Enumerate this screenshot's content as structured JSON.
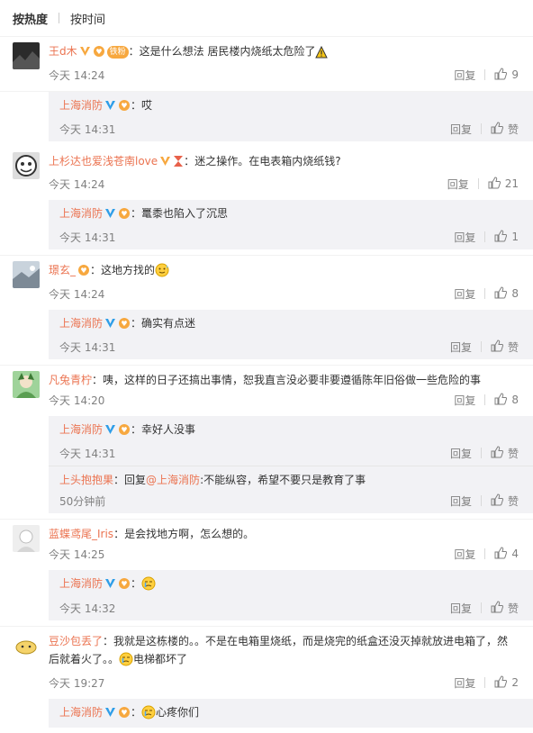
{
  "tabs": {
    "hot": "按热度",
    "time": "按时间"
  },
  "labels": {
    "reply": "回复",
    "like": "赞"
  },
  "comments": [
    {
      "user": "王d木",
      "sep": "：",
      "fan_badge": "铁粉",
      "text": "这是什么想法 居民楼内烧纸太危险了",
      "time": "今天 14:24",
      "likes": "9",
      "replies": [
        {
          "user": "上海消防",
          "sep": "：",
          "text": "哎",
          "time": "今天 14:31",
          "likes": "赞"
        }
      ]
    },
    {
      "user": "上杉达也爱浅苍南love",
      "sep": "：",
      "text": "迷之操作。在电表箱内烧纸钱?",
      "time": "今天 14:24",
      "likes": "21",
      "replies": [
        {
          "user": "上海消防",
          "sep": "：",
          "text": "鼍黍也陷入了沉思",
          "time": "今天 14:31",
          "likes": "1"
        }
      ]
    },
    {
      "user": "璟玄_",
      "sep": "：",
      "text": "这地方找的",
      "time": "今天 14:24",
      "likes": "8",
      "replies": [
        {
          "user": "上海消防",
          "sep": "：",
          "text": "确实有点迷",
          "time": "今天 14:31",
          "likes": "赞"
        }
      ]
    },
    {
      "user": "凡兔青柠",
      "sep": "：",
      "text": "咦，这样的日子还搞出事情，恕我直言没必要非要遵循陈年旧俗做一些危险的事",
      "time": "今天 14:20",
      "likes": "8",
      "replies": [
        {
          "user": "上海消防",
          "sep": "：",
          "text": "幸好人没事",
          "time": "今天 14:31",
          "likes": "赞"
        },
        {
          "user": "上头抱抱果",
          "sep": "：",
          "pre": "回复",
          "mention": "@上海消防",
          "text": ":不能纵容，希望不要只是教育了事",
          "time": "50分钟前",
          "likes": "赞"
        }
      ]
    },
    {
      "user": "蓝蝶鸢尾_Iris",
      "sep": "：",
      "text": "是会找地方啊，怎么想的。",
      "time": "今天 14:25",
      "likes": "4",
      "replies": [
        {
          "user": "上海消防",
          "sep": "：",
          "text": "",
          "time": "今天 14:32",
          "likes": "赞"
        }
      ]
    },
    {
      "user": "豆沙包丢了",
      "sep": "：",
      "text": "我就是这栋楼的。。不是在电箱里烧纸，而是烧完的纸盒还没灭掉就放进电箱了，然后就着火了。。",
      "text2": "电梯都坏了",
      "time": "今天 19:27",
      "likes": "2",
      "replies": [
        {
          "user": "上海消防",
          "sep": "：",
          "text": "心疼你们",
          "time": "",
          "likes": ""
        }
      ]
    }
  ],
  "colors": {
    "username": "#eb7350",
    "meta": "#808080",
    "reply_bg": "#f2f2f5",
    "vip": "#f7a83f"
  }
}
